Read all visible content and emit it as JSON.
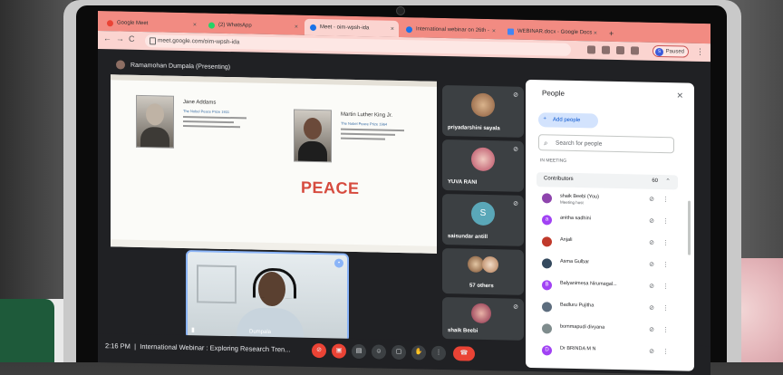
{
  "browser": {
    "tabs": [
      {
        "label": "Google Meet",
        "color": "#ea4335"
      },
      {
        "label": "(2) WhatsApp",
        "color": "#25d366"
      },
      {
        "label": "Meet - oim-wpsh-ida",
        "color": "#1a73e8"
      },
      {
        "label": "International webinar on 26th -",
        "color": "#1a73e8"
      },
      {
        "label": "WEBINAR.docx - Google Docs",
        "color": "#4285f4"
      }
    ],
    "url": "meet.google.com/oim-wpsh-ida",
    "profile_label": "Paused",
    "profile_initial": "S"
  },
  "meet": {
    "presenter": "Ramamohan Dumpala (Presenting)",
    "slide": {
      "left_name": "Jane Addams",
      "left_sub": "The Nobel Peace Prize 1931",
      "right_name": "Martin Luther King Jr.",
      "right_sub": "The Nobel Peace Prize 1964",
      "center_text": "PEACE"
    },
    "tiles": [
      {
        "name": "priyadarshini sayala"
      },
      {
        "name": "YUVA RANI"
      },
      {
        "name": "saisundar antill",
        "initial": "S"
      },
      {
        "name": "57 others"
      },
      {
        "name": "shaik Beebi"
      }
    ],
    "self_view_name": "Dumpala",
    "time": "2:16 PM",
    "meeting_title": "International Webinar : Exploring Research Tren..."
  },
  "people_panel": {
    "title": "People",
    "add_people": "Add people",
    "search_placeholder": "Search for people",
    "section": "IN MEETING",
    "group": "Contributors",
    "group_count": "60",
    "people": [
      {
        "name": "shaik Beebi (You)",
        "sub": "Meeting host",
        "color": "#8e44ad"
      },
      {
        "name": "anitha sadhini",
        "color": "#a142f4"
      },
      {
        "name": "Anjali",
        "color": "#c0392b"
      },
      {
        "name": "Asma Gulbar",
        "color": "#34495e"
      },
      {
        "name": "Balyanimesa Nirumagal...",
        "color": "#a142f4"
      },
      {
        "name": "Badluru Pujitha",
        "color": "#5d6d7e"
      },
      {
        "name": "bommapudi divyana",
        "color": "#7f8c8d"
      },
      {
        "name": "Dr BRINDA M N",
        "color": "#a142f4"
      }
    ]
  }
}
